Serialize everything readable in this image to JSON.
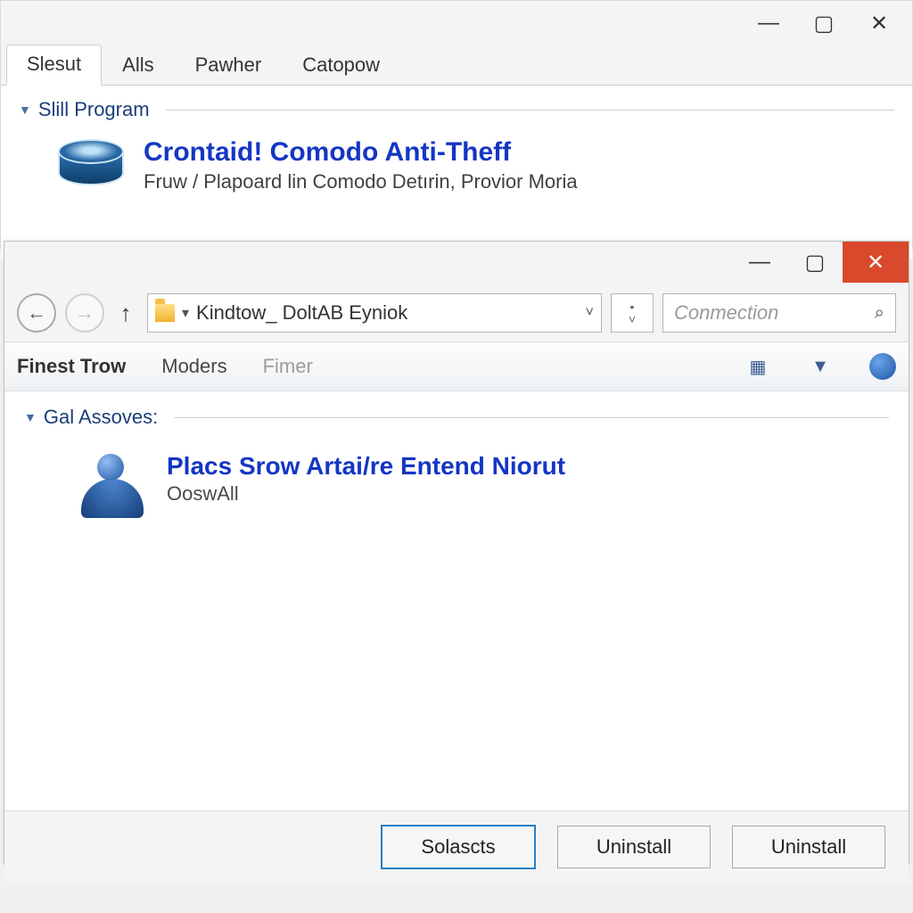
{
  "win1": {
    "tabs": [
      "Slesut",
      "Alls",
      "Pawher",
      "Catopow"
    ],
    "active_tab_index": 0,
    "section_label": "Slill Program",
    "program": {
      "title": "Crontaid! Comodo Anti-Theff",
      "subtitle": "Fruw / Plapoard lin Comodo Detırin, Provior Moria"
    }
  },
  "win2": {
    "address_text": "Kindtow_ DoltAB Eyniok",
    "search_placeholder": "Conmection",
    "toolbar": {
      "item1": "Finest Trow",
      "item2": "Moders",
      "item3": "Fimer"
    },
    "section_label": "Gal Assoves:",
    "entry": {
      "title": "Placs Srow Artai/re Entend Niorut",
      "subtitle": "OoswAll"
    },
    "buttons": {
      "primary": "Solascts",
      "b2": "Uninstall",
      "b3": "Uninstall"
    }
  }
}
